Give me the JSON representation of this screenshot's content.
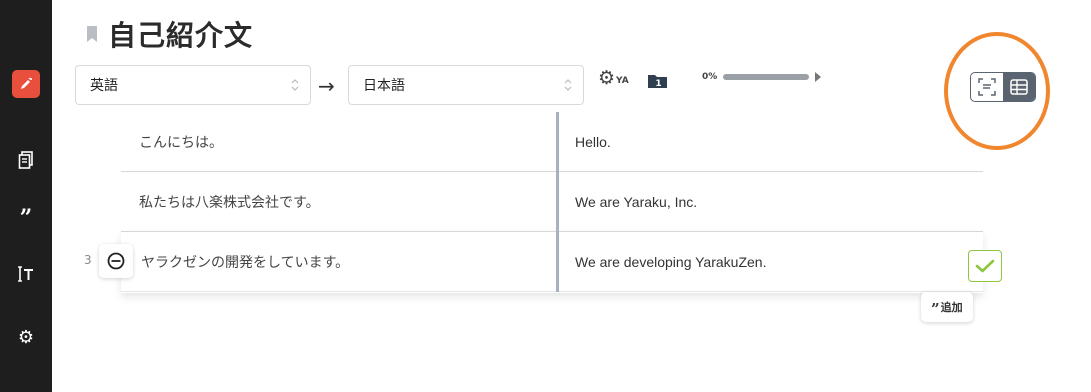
{
  "document": {
    "title": "自己紹介文"
  },
  "sidebar": {
    "items": [
      {
        "icon": "edit-icon",
        "active": true
      },
      {
        "icon": "documents-icon"
      },
      {
        "icon": "quote-icon"
      },
      {
        "icon": "text-cursor-icon"
      },
      {
        "icon": "gear-icon"
      }
    ]
  },
  "toolbar": {
    "source_language": "英語",
    "target_language": "日本語",
    "engine_badge": "YA",
    "folder_count": "1",
    "progress_label": "0%",
    "progress_value": 0
  },
  "segments": [
    {
      "number": "",
      "source": "こんにちは。",
      "target": "Hello."
    },
    {
      "number": "",
      "source": "私たちは八楽株式会社です。",
      "target": "We are Yaraku, Inc."
    },
    {
      "number": "3",
      "source": "ヤラクゼンの開発をしています。",
      "target": "We are developing YarakuZen."
    }
  ],
  "actions": {
    "add_label": "追加"
  },
  "colors": {
    "accent": "#e94f3d",
    "highlight": "#f0862e",
    "confirm": "#8dc63f",
    "toggle": "#5a6470"
  }
}
